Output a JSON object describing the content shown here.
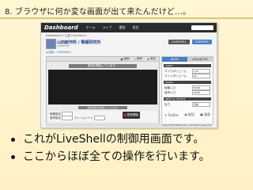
{
  "slide": {
    "title": "8. ブラウザに何か変な画面が出て来たんだけど…。",
    "bullets": [
      "これがLiveShellの制御用画面です。",
      "ここからほぼ全ての操作を行います。"
    ]
  },
  "screenshot": {
    "logo": "Dashboard",
    "nav": [
      "ホーム",
      "ライブ",
      "番組",
      "設定"
    ],
    "breadcrumb": "Dashboard > 山田 LiveShell >",
    "channel": {
      "name": "山田創作所 / 情報研究所",
      "sub": "LiveShell"
    },
    "channel_link": "山田組 : LIVESHELL",
    "header_buttons": [
      "LIVESHELL",
      "CONTROL"
    ],
    "player": {
      "toolbar": [
        "画面",
        "音声",
        "設定"
      ],
      "status": "配信を開始しています...",
      "caption": "配信状態を確認してください",
      "controls": [
        "映像設定",
        "音声設定",
        "フレームレート"
      ],
      "broadcast_button": "配信開始"
    },
    "panel": {
      "tabs": [
        "BASIC",
        "ADVANCED"
      ],
      "sections": [
        "VIDEO",
        "AUDIO",
        "INPUT & OUTPUT"
      ],
      "rows": [
        {
          "label": "マイクボリューム",
          "value": "100"
        },
        {
          "label": "ラインボリューム",
          "value": "80"
        },
        {
          "label": "映像入力",
          "value": "HDMI"
        },
        {
          "label": "音声入力",
          "value": "HDMI"
        },
        {
          "label": "出力",
          "value": "自動"
        }
      ]
    },
    "bottom_icons": [
      "Twitter",
      "配信",
      "録画"
    ],
    "footer": "Copyright CERevo Inc. All rights reserved."
  }
}
